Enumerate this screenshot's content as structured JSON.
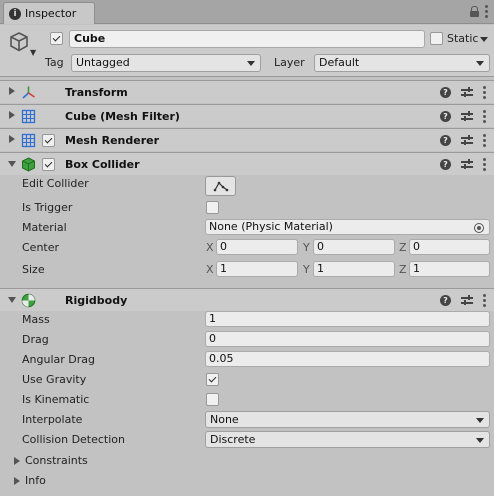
{
  "tab": {
    "label": "Inspector"
  },
  "gameobject": {
    "name": "Cube",
    "active": true,
    "static_label": "Static",
    "tag_label": "Tag",
    "tag_value": "Untagged",
    "layer_label": "Layer",
    "layer_value": "Default"
  },
  "components": {
    "transform": {
      "title": "Transform"
    },
    "mesh_filter": {
      "title": "Cube (Mesh Filter)"
    },
    "mesh_renderer": {
      "title": "Mesh Renderer",
      "enabled": true
    },
    "box_collider": {
      "title": "Box Collider",
      "enabled": true,
      "edit_collider_label": "Edit Collider",
      "is_trigger_label": "Is Trigger",
      "is_trigger": false,
      "material_label": "Material",
      "material_value": "None (Physic Material)",
      "center_label": "Center",
      "center": {
        "x": "0",
        "y": "0",
        "z": "0"
      },
      "size_label": "Size",
      "size": {
        "x": "1",
        "y": "1",
        "z": "1"
      }
    },
    "rigidbody": {
      "title": "Rigidbody",
      "mass_label": "Mass",
      "mass": "1",
      "drag_label": "Drag",
      "drag": "0",
      "angular_drag_label": "Angular Drag",
      "angular_drag": "0.05",
      "use_gravity_label": "Use Gravity",
      "use_gravity": true,
      "is_kinematic_label": "Is Kinematic",
      "is_kinematic": false,
      "interpolate_label": "Interpolate",
      "interpolate": "None",
      "collision_detection_label": "Collision Detection",
      "collision_detection": "Discrete",
      "constraints_label": "Constraints",
      "info_label": "Info"
    }
  },
  "axis": {
    "x": "X",
    "y": "Y",
    "z": "Z"
  },
  "icons": {
    "tab": "info-icon",
    "lock": "lock-icon",
    "menu": "kebab-menu-icon",
    "gameobject": "cube-outline-icon",
    "transform": "transform-axes-icon",
    "mesh_filter": "grid-icon",
    "mesh_renderer": "grid-icon",
    "box_collider": "green-cube-icon",
    "rigidbody": "rigidbody-sphere-icon",
    "help": "help-icon",
    "preset": "preset-sliders-icon",
    "edit_collider": "edit-collider-icon",
    "object_picker": "object-picker-icon"
  }
}
